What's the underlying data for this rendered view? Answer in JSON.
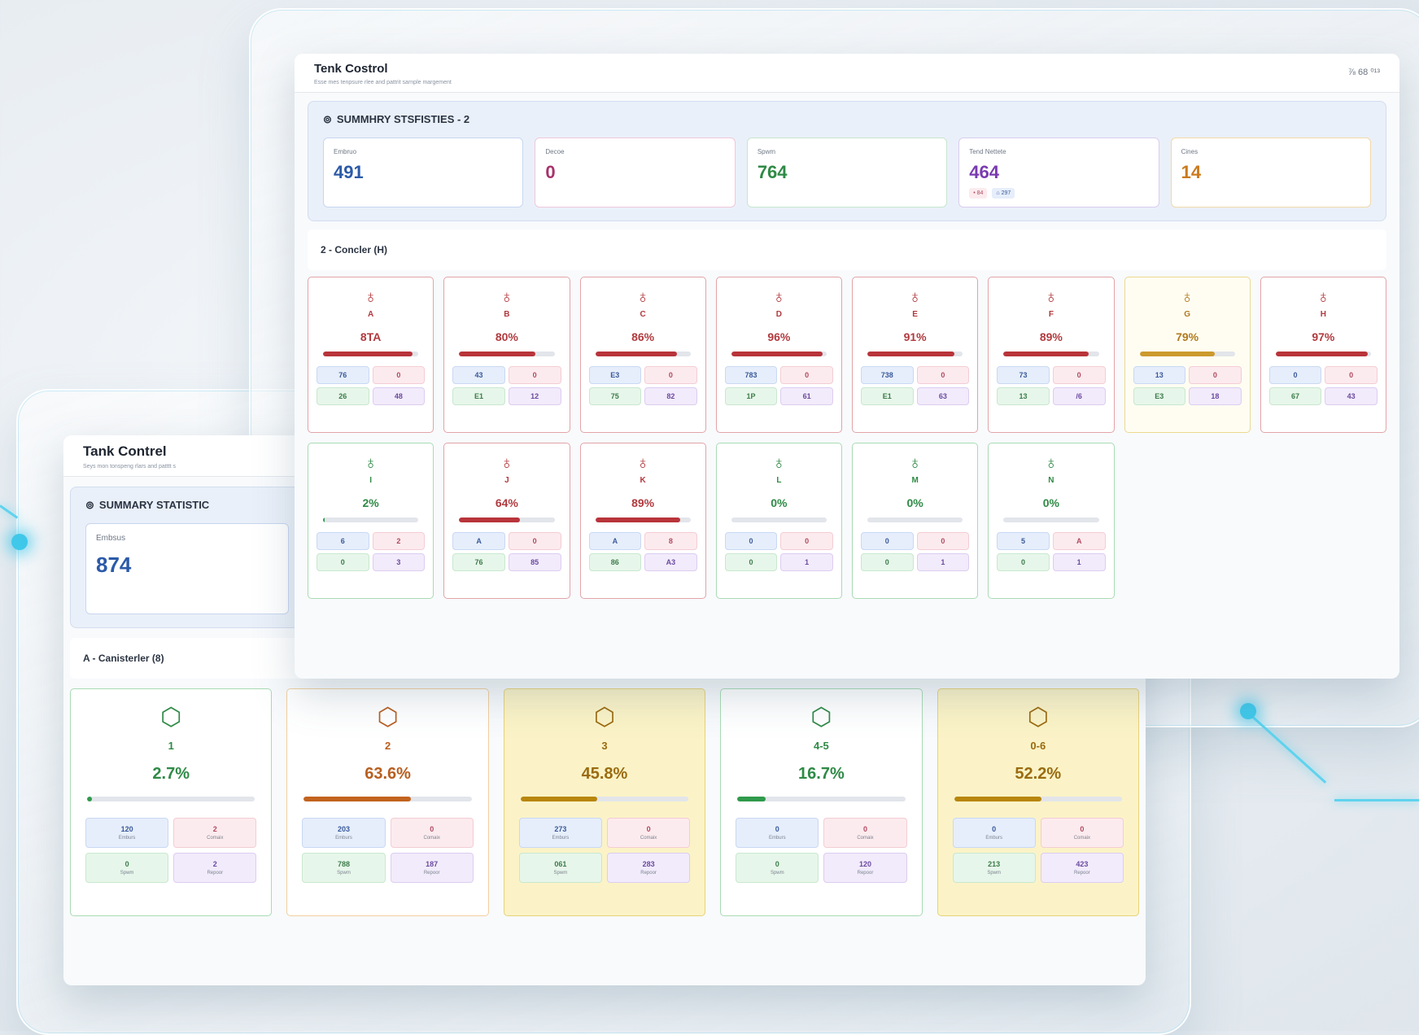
{
  "colors": {
    "accent_glow": "#40c8ea",
    "red": "#b13a3e",
    "yellow": "#b07a1e",
    "green": "#2f8a46",
    "orange": "#b85e20"
  },
  "front": {
    "title": "Tenk Costrol",
    "subtitle": "Esse mes tenpsure rlee and pattrit sarnple margement",
    "actions": "⅞ 68 ⁰¹³",
    "summary": {
      "icon": "⊚",
      "title": "SUMMHRY STSFISTIES - 2",
      "stats": [
        {
          "label": "Embruo",
          "value": "491",
          "color": "#2c5aa8",
          "border": "#c7d6f0"
        },
        {
          "label": "Decoe",
          "value": "0",
          "color": "#a8326a",
          "border": "#f0c7da"
        },
        {
          "label": "Spwm",
          "value": "764",
          "color": "#2f8a46",
          "border": "#c6e6ce"
        },
        {
          "label": "Tend Nettete",
          "value": "464",
          "color": "#7a3ab0",
          "border": "#dacdef",
          "tags": [
            "• 84",
            "⌂ 297"
          ]
        },
        {
          "label": "Cines",
          "value": "14",
          "color": "#cc7a1e",
          "border": "#f1d8a8"
        }
      ]
    },
    "section": "2 - Concler (H)",
    "cards": [
      {
        "icon": "♁",
        "name": "A",
        "pct": "8TA",
        "level": 0.94,
        "tone": "red",
        "minis": [
          "76",
          "0",
          "26",
          "48"
        ]
      },
      {
        "icon": "♁",
        "name": "B",
        "pct": "80%",
        "level": 0.8,
        "tone": "red",
        "minis": [
          "43",
          "0",
          "E1",
          "12"
        ]
      },
      {
        "icon": "♁",
        "name": "C",
        "pct": "86%",
        "level": 0.86,
        "tone": "red",
        "minis": [
          "E3",
          "0",
          "75",
          "82"
        ]
      },
      {
        "icon": "♁",
        "name": "D",
        "pct": "96%",
        "level": 0.96,
        "tone": "red",
        "minis": [
          "783",
          "0",
          "1P",
          "61"
        ]
      },
      {
        "icon": "♁",
        "name": "E",
        "pct": "91%",
        "level": 0.91,
        "tone": "red",
        "minis": [
          "738",
          "0",
          "E1",
          "63"
        ]
      },
      {
        "icon": "♁",
        "name": "F",
        "pct": "89%",
        "level": 0.89,
        "tone": "red",
        "minis": [
          "73",
          "0",
          "13",
          "/6"
        ]
      },
      {
        "icon": "♁",
        "name": "G",
        "pct": "79%",
        "level": 0.79,
        "tone": "yellow",
        "minis": [
          "13",
          "0",
          "E3",
          "18"
        ]
      },
      {
        "icon": "♁",
        "name": "H",
        "pct": "97%",
        "level": 0.97,
        "tone": "red",
        "minis": [
          "0",
          "0",
          "67",
          "43"
        ]
      },
      {
        "icon": "♁",
        "name": "I",
        "pct": "2%",
        "level": 0.02,
        "tone": "green",
        "minis": [
          "6",
          "2",
          "0",
          "3"
        ]
      },
      {
        "icon": "♁",
        "name": "J",
        "pct": "64%",
        "level": 0.64,
        "tone": "red",
        "minis": [
          "A",
          "0",
          "76",
          "85"
        ]
      },
      {
        "icon": "♁",
        "name": "K",
        "pct": "89%",
        "level": 0.89,
        "tone": "red",
        "minis": [
          "A",
          "8",
          "86",
          "A3"
        ]
      },
      {
        "icon": "♁",
        "name": "L",
        "pct": "0%",
        "level": 0,
        "tone": "green",
        "minis": [
          "0",
          "0",
          "0",
          "1"
        ]
      },
      {
        "icon": "♁",
        "name": "M",
        "pct": "0%",
        "level": 0,
        "tone": "green",
        "minis": [
          "0",
          "0",
          "0",
          "1"
        ]
      },
      {
        "icon": "♁",
        "name": "N",
        "pct": "0%",
        "level": 0,
        "tone": "green",
        "minis": [
          "5",
          "A",
          "0",
          "1"
        ]
      }
    ]
  },
  "back": {
    "title": "Tank Contrel",
    "subtitle": "Seys mon tonspeng rlars and patttt s",
    "summary": {
      "icon": "⊚",
      "title": "SUMMARY STATISTIC",
      "stats": [
        {
          "label": "Embsus",
          "value": "874",
          "color": "#2c5aa8",
          "border": "#c7d6f0"
        }
      ]
    },
    "section": "A - Canisterler (8)",
    "mini_labels": [
      "Emburs",
      "Comaix",
      "Spwm",
      "Repoor"
    ],
    "cards": [
      {
        "icon": "⬡",
        "name": "1",
        "pct": "2.7%",
        "level": 0.027,
        "tone": "green",
        "minis": [
          "120",
          "2",
          "0",
          "2"
        ]
      },
      {
        "icon": "⬡",
        "name": "2",
        "pct": "63.6%",
        "level": 0.636,
        "tone": "orange",
        "minis": [
          "203",
          "0",
          "788",
          "187"
        ]
      },
      {
        "icon": "⬡",
        "name": "3",
        "pct": "45.8%",
        "level": 0.458,
        "tone": "gold",
        "minis": [
          "273",
          "0",
          "061",
          "283"
        ]
      },
      {
        "icon": "⬡",
        "name": "4-5",
        "pct": "16.7%",
        "level": 0.167,
        "tone": "green",
        "minis": [
          "0",
          "0",
          "0",
          "120"
        ]
      },
      {
        "icon": "⬡",
        "name": "0-6",
        "pct": "52.2%",
        "level": 0.522,
        "tone": "gold",
        "minis": [
          "0",
          "0",
          "213",
          "423"
        ]
      }
    ]
  }
}
